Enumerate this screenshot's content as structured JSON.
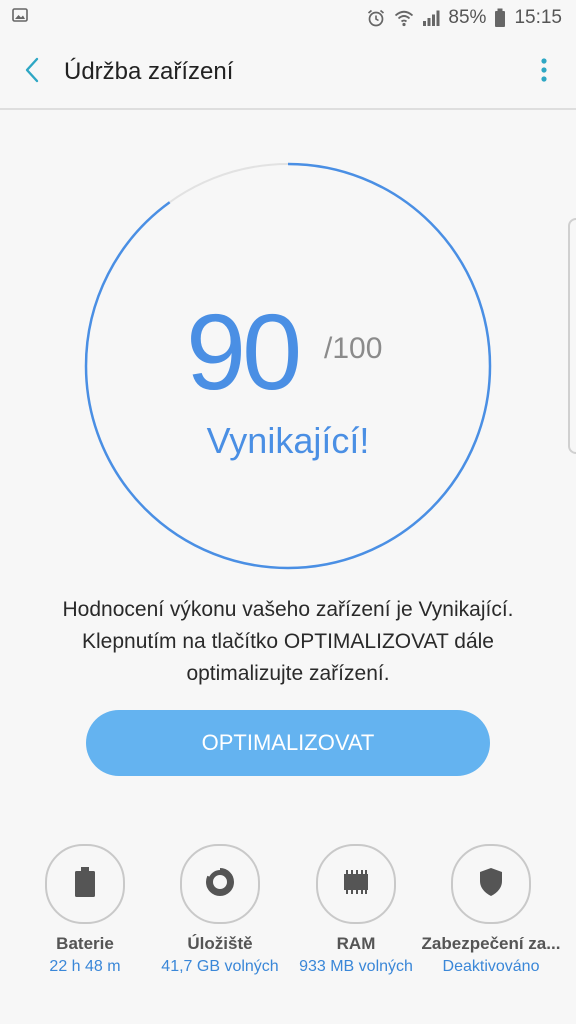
{
  "status_bar": {
    "battery_percent": "85%",
    "time": "15:15",
    "icons": [
      "image-icon",
      "alarm-icon",
      "wifi-icon",
      "signal-icon",
      "battery-icon"
    ]
  },
  "app_bar": {
    "title": "Údržba zařízení",
    "back_icon": "chevron-left-icon",
    "menu_icon": "more-vertical-icon"
  },
  "score": {
    "value": "90",
    "max": "/100",
    "fraction": 0.9,
    "rating": "Vynikající!"
  },
  "description": {
    "line1": "Hodnocení výkonu vašeho zařízení je Vynikající.",
    "line2": "Klepnutím na tlačítko OPTIMALIZOVAT dále",
    "line3": "optimalizujte zařízení."
  },
  "optimize_button": {
    "label": "OPTIMALIZOVAT"
  },
  "tiles": [
    {
      "name": "Baterie",
      "value": "22 h 48 m",
      "icon": "battery-icon"
    },
    {
      "name": "Úložiště",
      "value": "41,7 GB volných",
      "icon": "storage-icon"
    },
    {
      "name": "RAM",
      "value": "933 MB volných",
      "icon": "ram-chip-icon"
    },
    {
      "name": "Zabezpečení za...",
      "value": "Deaktivováno",
      "icon": "shield-icon"
    }
  ],
  "colors": {
    "accent": "#4a8fe4",
    "button": "#64b3f0",
    "background": "#f7f7f7",
    "track": "#e4e4e4",
    "link": "#3a87d8"
  }
}
